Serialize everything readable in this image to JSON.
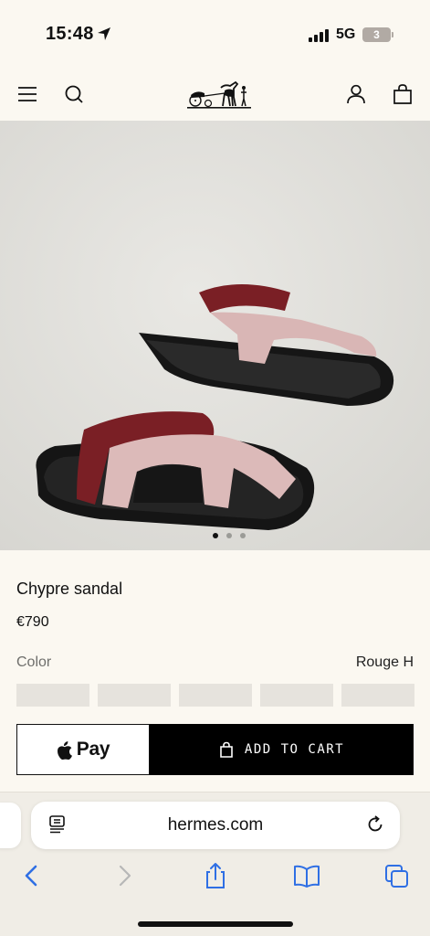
{
  "status_bar": {
    "time": "15:48",
    "network": "5G",
    "battery": "3"
  },
  "header": {
    "icons": [
      "menu-icon",
      "search-icon",
      "hermes-logo",
      "account-icon",
      "shopping-bag-icon"
    ]
  },
  "gallery": {
    "total_images": 3,
    "active_index": 0
  },
  "product": {
    "name": "Chypre sandal",
    "price": "€790",
    "color_label": "Color",
    "color_value": "Rouge H",
    "swatch_count": 5
  },
  "actions": {
    "apple_pay_label": "Pay",
    "add_to_cart_label": "ADD TO CART"
  },
  "browser": {
    "url": "hermes.com",
    "accent": "#2f6fe4"
  }
}
